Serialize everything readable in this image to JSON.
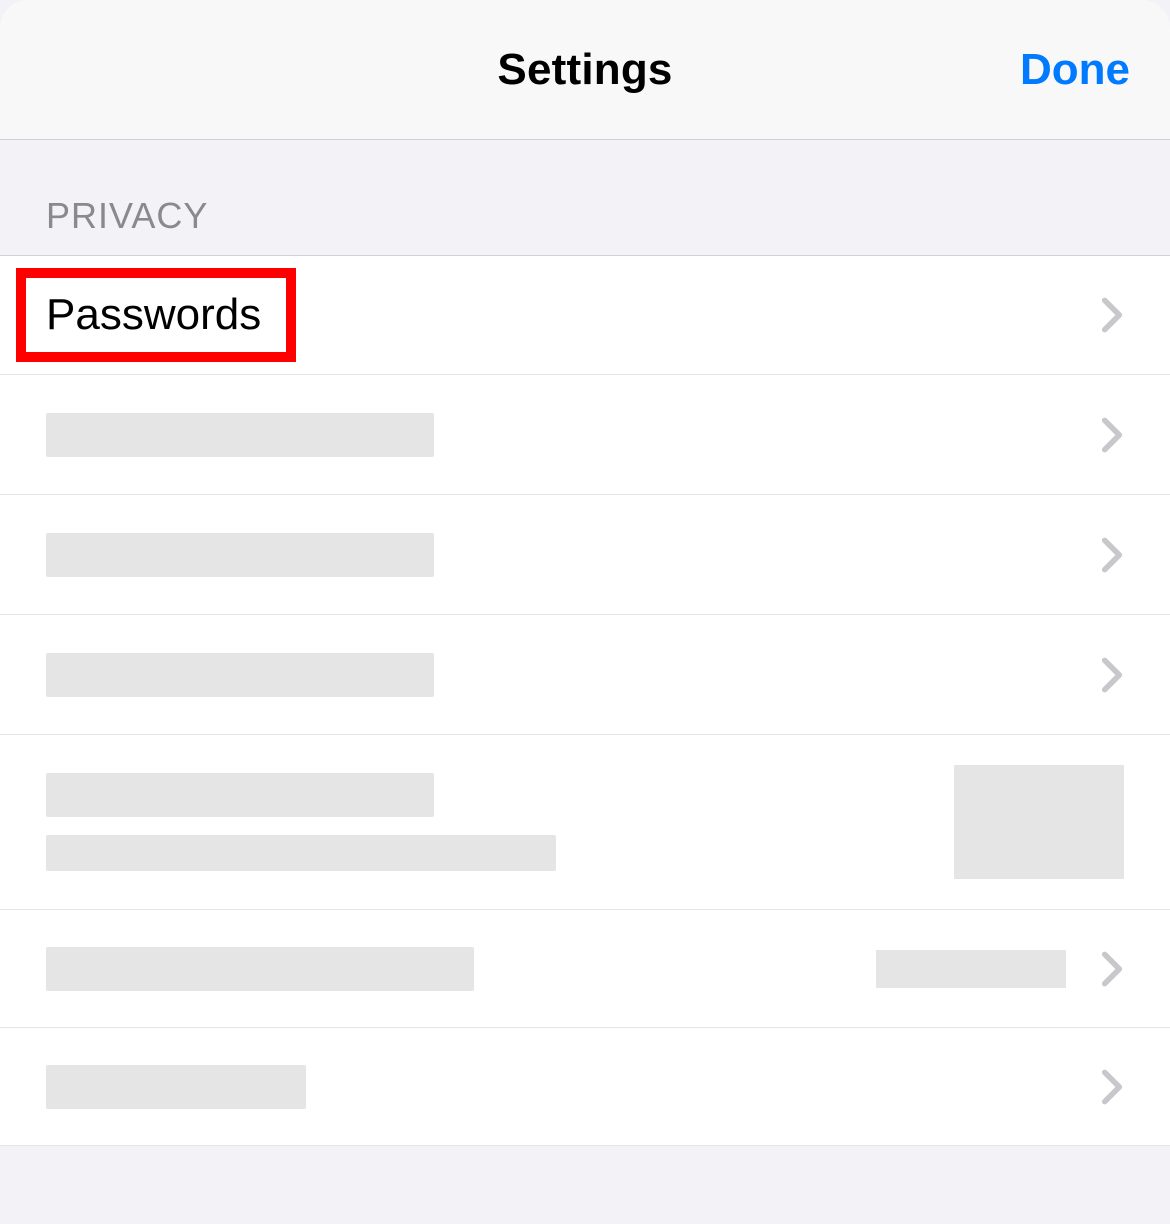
{
  "header": {
    "title": "Settings",
    "done_label": "Done"
  },
  "section": {
    "title": "PRIVACY"
  },
  "rows": {
    "passwords_label": "Passwords"
  },
  "colors": {
    "accent": "#007aff",
    "highlight": "#ff0000"
  }
}
